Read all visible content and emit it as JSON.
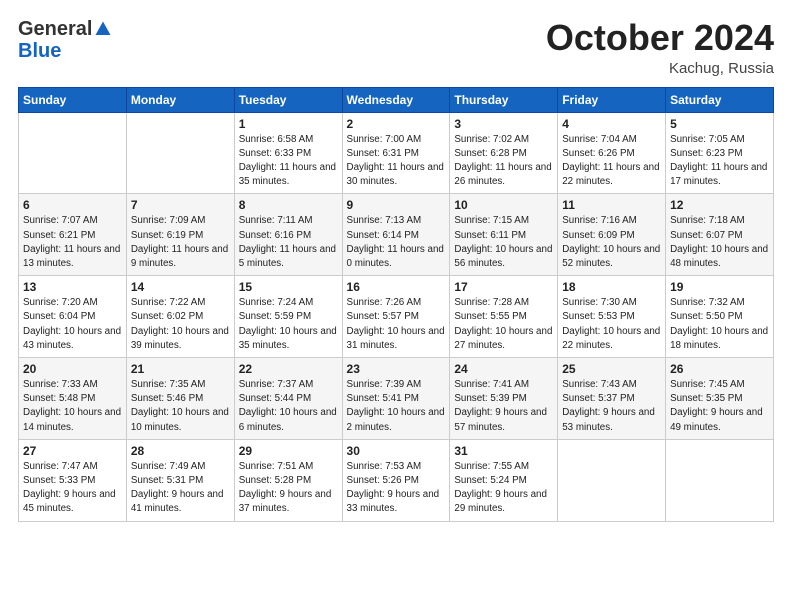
{
  "header": {
    "logo_general": "General",
    "logo_blue": "Blue",
    "month": "October 2024",
    "location": "Kachug, Russia"
  },
  "weekdays": [
    "Sunday",
    "Monday",
    "Tuesday",
    "Wednesday",
    "Thursday",
    "Friday",
    "Saturday"
  ],
  "weeks": [
    [
      {
        "day": "",
        "sunrise": "",
        "sunset": "",
        "daylight": ""
      },
      {
        "day": "",
        "sunrise": "",
        "sunset": "",
        "daylight": ""
      },
      {
        "day": "1",
        "sunrise": "Sunrise: 6:58 AM",
        "sunset": "Sunset: 6:33 PM",
        "daylight": "Daylight: 11 hours and 35 minutes."
      },
      {
        "day": "2",
        "sunrise": "Sunrise: 7:00 AM",
        "sunset": "Sunset: 6:31 PM",
        "daylight": "Daylight: 11 hours and 30 minutes."
      },
      {
        "day": "3",
        "sunrise": "Sunrise: 7:02 AM",
        "sunset": "Sunset: 6:28 PM",
        "daylight": "Daylight: 11 hours and 26 minutes."
      },
      {
        "day": "4",
        "sunrise": "Sunrise: 7:04 AM",
        "sunset": "Sunset: 6:26 PM",
        "daylight": "Daylight: 11 hours and 22 minutes."
      },
      {
        "day": "5",
        "sunrise": "Sunrise: 7:05 AM",
        "sunset": "Sunset: 6:23 PM",
        "daylight": "Daylight: 11 hours and 17 minutes."
      }
    ],
    [
      {
        "day": "6",
        "sunrise": "Sunrise: 7:07 AM",
        "sunset": "Sunset: 6:21 PM",
        "daylight": "Daylight: 11 hours and 13 minutes."
      },
      {
        "day": "7",
        "sunrise": "Sunrise: 7:09 AM",
        "sunset": "Sunset: 6:19 PM",
        "daylight": "Daylight: 11 hours and 9 minutes."
      },
      {
        "day": "8",
        "sunrise": "Sunrise: 7:11 AM",
        "sunset": "Sunset: 6:16 PM",
        "daylight": "Daylight: 11 hours and 5 minutes."
      },
      {
        "day": "9",
        "sunrise": "Sunrise: 7:13 AM",
        "sunset": "Sunset: 6:14 PM",
        "daylight": "Daylight: 11 hours and 0 minutes."
      },
      {
        "day": "10",
        "sunrise": "Sunrise: 7:15 AM",
        "sunset": "Sunset: 6:11 PM",
        "daylight": "Daylight: 10 hours and 56 minutes."
      },
      {
        "day": "11",
        "sunrise": "Sunrise: 7:16 AM",
        "sunset": "Sunset: 6:09 PM",
        "daylight": "Daylight: 10 hours and 52 minutes."
      },
      {
        "day": "12",
        "sunrise": "Sunrise: 7:18 AM",
        "sunset": "Sunset: 6:07 PM",
        "daylight": "Daylight: 10 hours and 48 minutes."
      }
    ],
    [
      {
        "day": "13",
        "sunrise": "Sunrise: 7:20 AM",
        "sunset": "Sunset: 6:04 PM",
        "daylight": "Daylight: 10 hours and 43 minutes."
      },
      {
        "day": "14",
        "sunrise": "Sunrise: 7:22 AM",
        "sunset": "Sunset: 6:02 PM",
        "daylight": "Daylight: 10 hours and 39 minutes."
      },
      {
        "day": "15",
        "sunrise": "Sunrise: 7:24 AM",
        "sunset": "Sunset: 5:59 PM",
        "daylight": "Daylight: 10 hours and 35 minutes."
      },
      {
        "day": "16",
        "sunrise": "Sunrise: 7:26 AM",
        "sunset": "Sunset: 5:57 PM",
        "daylight": "Daylight: 10 hours and 31 minutes."
      },
      {
        "day": "17",
        "sunrise": "Sunrise: 7:28 AM",
        "sunset": "Sunset: 5:55 PM",
        "daylight": "Daylight: 10 hours and 27 minutes."
      },
      {
        "day": "18",
        "sunrise": "Sunrise: 7:30 AM",
        "sunset": "Sunset: 5:53 PM",
        "daylight": "Daylight: 10 hours and 22 minutes."
      },
      {
        "day": "19",
        "sunrise": "Sunrise: 7:32 AM",
        "sunset": "Sunset: 5:50 PM",
        "daylight": "Daylight: 10 hours and 18 minutes."
      }
    ],
    [
      {
        "day": "20",
        "sunrise": "Sunrise: 7:33 AM",
        "sunset": "Sunset: 5:48 PM",
        "daylight": "Daylight: 10 hours and 14 minutes."
      },
      {
        "day": "21",
        "sunrise": "Sunrise: 7:35 AM",
        "sunset": "Sunset: 5:46 PM",
        "daylight": "Daylight: 10 hours and 10 minutes."
      },
      {
        "day": "22",
        "sunrise": "Sunrise: 7:37 AM",
        "sunset": "Sunset: 5:44 PM",
        "daylight": "Daylight: 10 hours and 6 minutes."
      },
      {
        "day": "23",
        "sunrise": "Sunrise: 7:39 AM",
        "sunset": "Sunset: 5:41 PM",
        "daylight": "Daylight: 10 hours and 2 minutes."
      },
      {
        "day": "24",
        "sunrise": "Sunrise: 7:41 AM",
        "sunset": "Sunset: 5:39 PM",
        "daylight": "Daylight: 9 hours and 57 minutes."
      },
      {
        "day": "25",
        "sunrise": "Sunrise: 7:43 AM",
        "sunset": "Sunset: 5:37 PM",
        "daylight": "Daylight: 9 hours and 53 minutes."
      },
      {
        "day": "26",
        "sunrise": "Sunrise: 7:45 AM",
        "sunset": "Sunset: 5:35 PM",
        "daylight": "Daylight: 9 hours and 49 minutes."
      }
    ],
    [
      {
        "day": "27",
        "sunrise": "Sunrise: 7:47 AM",
        "sunset": "Sunset: 5:33 PM",
        "daylight": "Daylight: 9 hours and 45 minutes."
      },
      {
        "day": "28",
        "sunrise": "Sunrise: 7:49 AM",
        "sunset": "Sunset: 5:31 PM",
        "daylight": "Daylight: 9 hours and 41 minutes."
      },
      {
        "day": "29",
        "sunrise": "Sunrise: 7:51 AM",
        "sunset": "Sunset: 5:28 PM",
        "daylight": "Daylight: 9 hours and 37 minutes."
      },
      {
        "day": "30",
        "sunrise": "Sunrise: 7:53 AM",
        "sunset": "Sunset: 5:26 PM",
        "daylight": "Daylight: 9 hours and 33 minutes."
      },
      {
        "day": "31",
        "sunrise": "Sunrise: 7:55 AM",
        "sunset": "Sunset: 5:24 PM",
        "daylight": "Daylight: 9 hours and 29 minutes."
      },
      {
        "day": "",
        "sunrise": "",
        "sunset": "",
        "daylight": ""
      },
      {
        "day": "",
        "sunrise": "",
        "sunset": "",
        "daylight": ""
      }
    ]
  ]
}
